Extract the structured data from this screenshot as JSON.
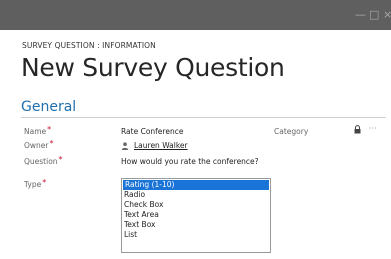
{
  "window": {
    "controls": {
      "minimize": "—",
      "maximize": "□",
      "close": "×"
    }
  },
  "header": {
    "breadcrumb": "SURVEY QUESTION : INFORMATION",
    "title": "New Survey Question"
  },
  "section": {
    "title": "General"
  },
  "fields": {
    "name": {
      "label": "Name",
      "required": "*",
      "value": "Rate Conference"
    },
    "owner": {
      "label": "Owner",
      "required": "*",
      "value": "Lauren Walker",
      "icon": "user-icon"
    },
    "question": {
      "label": "Question",
      "required": "*",
      "value": "How would you rate the conference?"
    },
    "type": {
      "label": "Type",
      "required": "*",
      "selected": "Rating (1-10)",
      "options": [
        "Rating (1-10)",
        "Radio",
        "Check Box",
        "Text Area",
        "Text Box",
        "List"
      ]
    },
    "category": {
      "label": "Category",
      "icon": "lock-icon",
      "more": "···"
    }
  },
  "colors": {
    "titlebar": "#5f5f5f",
    "accent": "#1f6fae",
    "selection": "#1a73d6",
    "required": "#c8102e"
  }
}
